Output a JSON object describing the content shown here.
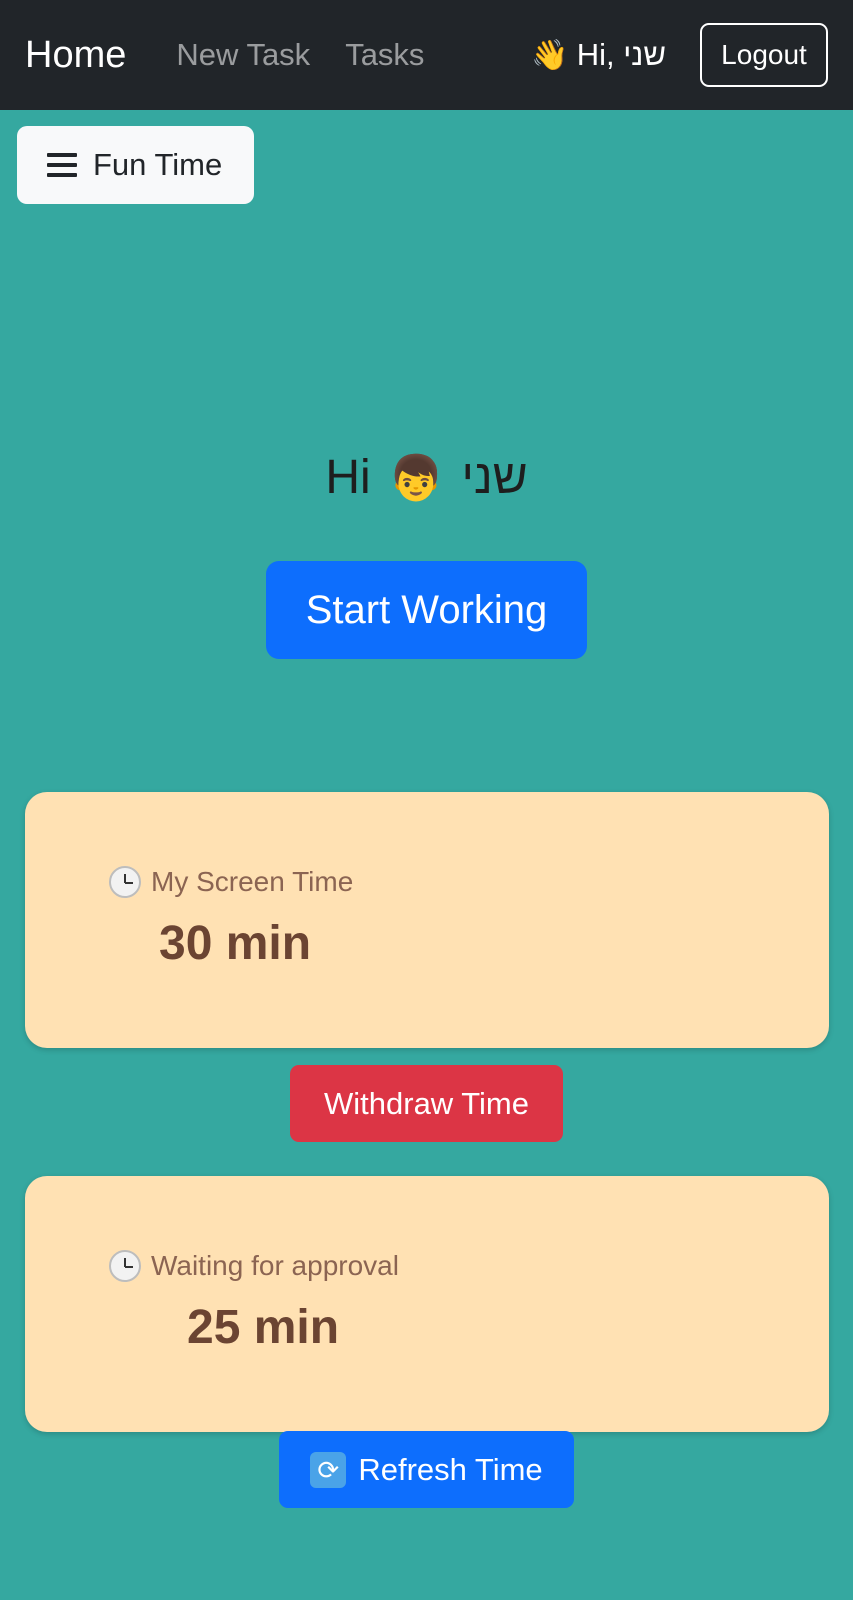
{
  "navbar": {
    "brand": "Home",
    "links": [
      "New Task",
      "Tasks"
    ],
    "greeting_icon": "waving-hand-icon",
    "greeting_emoji": "👋",
    "greeting_text": "Hi, שני",
    "logout_label": "Logout",
    "background_color": "#212529"
  },
  "menu_button": {
    "icon": "hamburger-icon",
    "label": "Fun Time"
  },
  "hero": {
    "hello": "Hi",
    "avatar_icon": "boy-icon",
    "avatar_emoji": "👦",
    "name": "שני",
    "start_label": "Start Working"
  },
  "cards": [
    {
      "icon": "clock-icon",
      "label": "My Screen Time",
      "value": "30 min"
    },
    {
      "icon": "clock-icon",
      "label": "Waiting for approval",
      "value": "25 min"
    }
  ],
  "buttons": {
    "withdraw_label": "Withdraw Time",
    "refresh_icon": "refresh-icon",
    "refresh_label": "Refresh Time"
  },
  "colors": {
    "page_background": "#35a8a0",
    "card_background": "#ffe1b3",
    "primary": "#0d6efd",
    "danger": "#dc3545"
  }
}
